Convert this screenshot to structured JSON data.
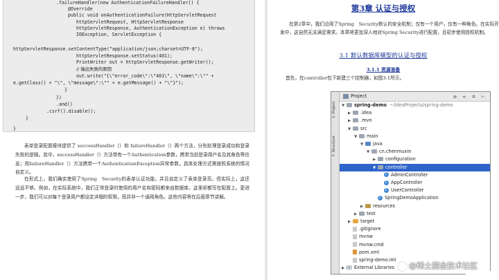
{
  "left_page": {
    "code_lines": [
      ".failureHandler(new AuthenticationFailureHandler() {",
      "@Override",
      "public void onAuthenticationFailure(HttpServletRequest",
      "httpServletRequest, HttpServletResponse",
      "httpServletResponse, AuthenticationException e) throws",
      "IOException, ServletException {",
      "",
      "httpServletResponse.setContentType(\"application/json;charset=UTF-8\");",
      "httpServletResponse.setStatus(401);",
      "PrintWriter out = httpServletResponse.getWriter();",
      "// 输出失败的原因",
      "out.write(\"{\\\"error_code\\\":\\\"401\\\", \\\"name\\\":\\\"\" +",
      "e.getClass() + \"\\\", \\\"message\\\":\\\"\" + e.getMessage() + \"\\\"}\");",
      "}",
      "})",
      ".and()",
      ".csrf().disable();",
      "}",
      "",
      "}"
    ],
    "paragraphs": [
      "表单登录配置模块提供了 successHandler（）和 failureHandler（）两个方法，分别处理登录成功和登录失败的逻辑。其中，successHandler（）方法带有一个Authentication参数，携带当前登录用户名及其角色等信息；而failureHandler（）方法携带一个AuthenticationException异常参数。具体处理方式需按照系统的情况自定义。",
      "在形式上，我们确实使用了Spring　Security的表单认证功能，并且自定义了表单登录页。但实际上，这还远远不够。例如，在实际系统中，我们正常登录时使用的用户名和密码都来自数据库，这里却都写在配置上。更进一步，我们可以对每个登录用户都设定详细的权限，而并非一个通用角色。这些内容将在后面章节讲解。"
    ]
  },
  "right_page": {
    "chapter_title": "第3章 认证与授权",
    "intro": "在第2章中，我们沿用了Spring　Security默认的安全机制；仅有一个用户，仅有一种角色。在实际开发中，这自然无法满足需求。本章将更加深入地对Spring Security进行配置，且初步使用授权机制。",
    "section_title": "3.1 默认数据库模型的认证与授权",
    "subsection_title": "3.1.1 资源准备",
    "subsection_para": "首先，在controller包下新建三个控制器，如图3-1所示。",
    "ide": {
      "header_label": "Project",
      "header_icons": "⊕ ≑ ✲ ⊢",
      "side_tabs": [
        "1: Project",
        "7: Structure"
      ],
      "tree": [
        {
          "label": "spring-demo",
          "suffix": "~/IdeaProjects/spring-demo",
          "type": "folder",
          "indent": 0,
          "arrow": "▼",
          "bold": true
        },
        {
          "label": ".idea",
          "type": "folder",
          "indent": 1,
          "arrow": "▶"
        },
        {
          "label": ".mvn",
          "type": "folder",
          "indent": 1,
          "arrow": "▶"
        },
        {
          "label": "src",
          "type": "folder",
          "indent": 1,
          "arrow": "▼"
        },
        {
          "label": "main",
          "type": "folder",
          "indent": 2,
          "arrow": "▼"
        },
        {
          "label": "java",
          "type": "src",
          "indent": 3,
          "arrow": "▼"
        },
        {
          "label": "cn.chenmuxin",
          "type": "folder",
          "indent": 4,
          "arrow": "▼"
        },
        {
          "label": "configuration",
          "type": "folder",
          "indent": 5,
          "arrow": "▶"
        },
        {
          "label": "controller",
          "type": "folder",
          "indent": 5,
          "arrow": "▼",
          "selected": true
        },
        {
          "label": "AdminController",
          "type": "class",
          "indent": 6,
          "arrow": ""
        },
        {
          "label": "AppController",
          "type": "class",
          "indent": 6,
          "arrow": ""
        },
        {
          "label": "UserController",
          "type": "class",
          "indent": 6,
          "arrow": ""
        },
        {
          "label": "SpringDemoApplication",
          "type": "class",
          "indent": 5,
          "arrow": ""
        },
        {
          "label": "resources",
          "type": "res",
          "indent": 3,
          "arrow": "▶"
        },
        {
          "label": "test",
          "type": "folder",
          "indent": 2,
          "arrow": "▶"
        },
        {
          "label": "target",
          "type": "target",
          "indent": 1,
          "arrow": "▶"
        },
        {
          "label": ".gitignore",
          "type": "file",
          "indent": 1,
          "arrow": ""
        },
        {
          "label": "mvnw",
          "type": "file",
          "indent": 1,
          "arrow": ""
        },
        {
          "label": "mvnw.cmd",
          "type": "file",
          "indent": 1,
          "arrow": ""
        },
        {
          "label": "pom.xml",
          "type": "xml",
          "indent": 1,
          "arrow": ""
        },
        {
          "label": "spring-demo.iml",
          "type": "file",
          "indent": 1,
          "arrow": ""
        },
        {
          "label": "External Libraries",
          "type": "lib",
          "indent": 0,
          "arrow": "▶"
        }
      ]
    }
  },
  "watermark": "@稀土掘金技术社区"
}
